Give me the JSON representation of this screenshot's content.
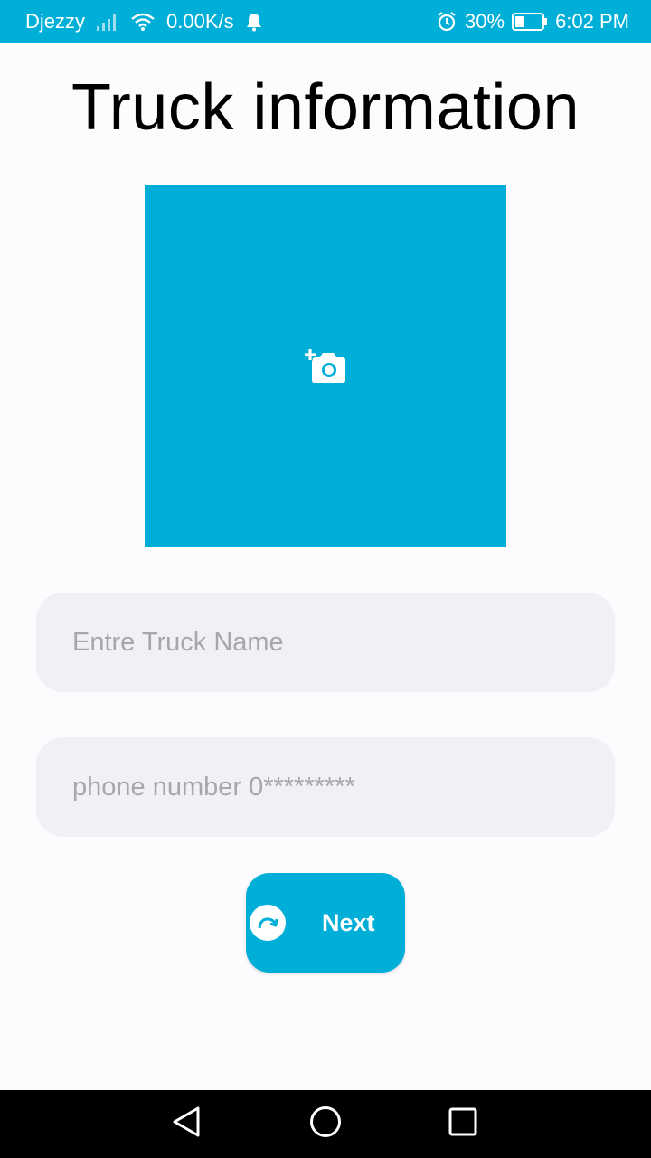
{
  "status_bar": {
    "carrier": "Djezzy",
    "net_speed": "0.00K/s",
    "battery_percent": "30%",
    "time": "6:02 PM",
    "icons": [
      "signal-icon",
      "wifi-icon",
      "notification-bell-icon",
      "alarm-icon",
      "battery-icon"
    ]
  },
  "page": {
    "title": "Truck information"
  },
  "photo": {
    "icon": "add-photo-camera-icon"
  },
  "form": {
    "truck_name_placeholder": "Entre Truck Name",
    "truck_name_value": "",
    "phone_placeholder": "phone number 0*********",
    "phone_value": ""
  },
  "next_button": {
    "label": "Next",
    "icon": "redo-arrow-icon"
  },
  "nav_bar": {
    "icons": [
      "back-triangle-icon",
      "home-circle-icon",
      "recents-square-icon"
    ]
  },
  "colors": {
    "accent": "#00afd8",
    "field_bg": "#f0f0f5",
    "page_bg": "#fdfbfe"
  }
}
